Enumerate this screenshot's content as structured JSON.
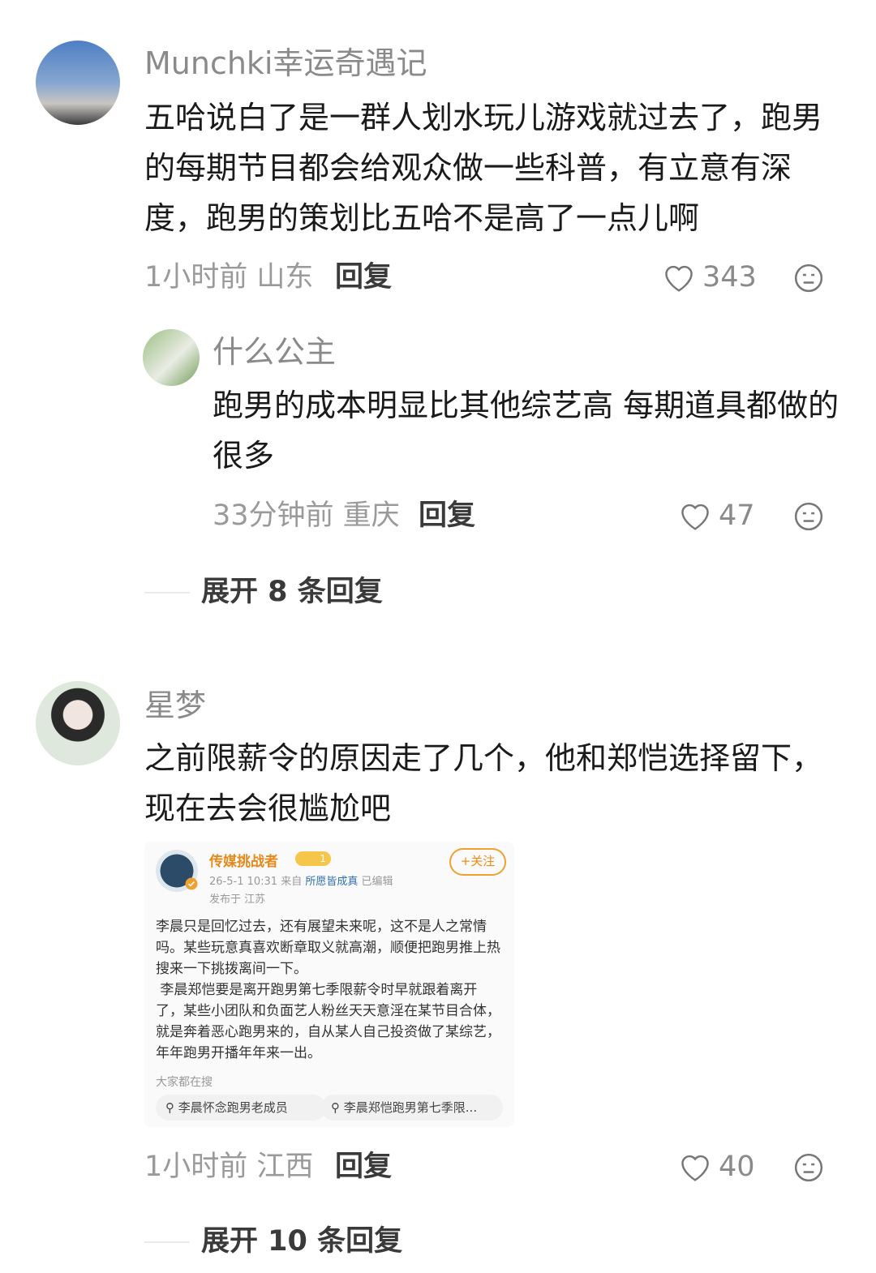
{
  "comments": [
    {
      "username": "Munchki幸运奇遇记",
      "text": "五哈说白了是一群人划水玩儿游戏就过去了，跑男的每期节目都会给观众做一些科普，有立意有深度，跑男的策划比五哈不是高了一点儿啊",
      "time": "1小时前",
      "location": "山东",
      "reply_label": "回复",
      "likes": "343",
      "replies": [
        {
          "username": "什么公主",
          "text": "跑男的成本明显比其他综艺高 每期道具都做的很多",
          "time": "33分钟前",
          "location": "重庆",
          "reply_label": "回复",
          "likes": "47"
        }
      ],
      "expand_label": "展开 8 条回复"
    },
    {
      "username": "星梦",
      "text": "之前限薪令的原因走了几个，他和郑恺选择留下，现在去会很尴尬吧",
      "time": "1小时前",
      "location": "江西",
      "reply_label": "回复",
      "likes": "40",
      "expand_label": "展开 10 条回复",
      "embedded": {
        "name": "传媒挑战者",
        "level": "1",
        "follow": "+关注",
        "date": "26-5-1 10:31",
        "source_prefix": "来自",
        "source": "所愿皆成真",
        "edited": "已编辑",
        "location": "发布于 江苏",
        "body": "李晨只是回忆过去，还有展望未来呢，这不是人之常情吗。某些玩意真喜欢断章取义就高潮，顺便把跑男推上热搜来一下挑拨离间一下。\n 李晨郑恺要是离开跑男第七季限薪令时早就跟着离开了，某些小团队和负面艺人粉丝天天意淫在某节目合体，就是奔着恶心跑男来的，自从某人自己投资做了某综艺，年年跑男开播年年来一出。",
        "search_title": "大家都在搜",
        "chips": [
          "李晨怀念跑男老成员",
          "李晨郑恺跑男第七季限..."
        ]
      }
    }
  ],
  "colors": {
    "username": "#8a8a8a",
    "meta": "#9a9a9a",
    "accent": "#f08a10"
  },
  "icons": [
    "heart-icon",
    "dislike-face-icon",
    "search-icon",
    "verified-badge-icon"
  ]
}
